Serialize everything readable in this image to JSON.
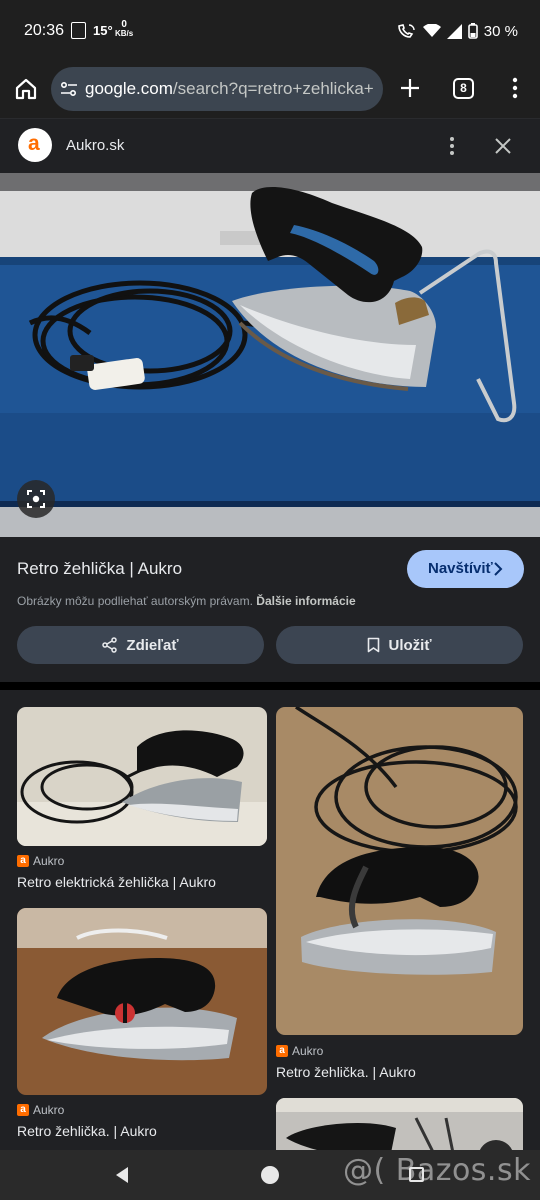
{
  "status_bar": {
    "time": "20:36",
    "temperature": "15°",
    "net_speed_value": "0",
    "net_speed_unit": "KB/s",
    "battery": "30 %"
  },
  "url_bar": {
    "host": "google.com",
    "path": "/search?q=retro+zehlicka+",
    "tab_count": "8"
  },
  "preview": {
    "source_logo_letter": "a",
    "source_name": "Aukro.sk",
    "title": "Retro žehlička | Aukro",
    "visit_label": "Navštíviť",
    "copyright_text": "Obrázky môžu podliehať autorským právam.",
    "more_info_label": "Ďalšie informácie",
    "share_label": "Zdieľať",
    "save_label": "Uložiť"
  },
  "results": [
    {
      "source": "Aukro",
      "title": "Retro elektrická žehlička | Aukro"
    },
    {
      "source": "Aukro",
      "title": "Retro žehlička. | Aukro"
    },
    {
      "source": "Aukro",
      "title": "Retro žehlička. | Aukro"
    },
    {
      "source": "",
      "title": ""
    }
  ],
  "watermark": "@( Bazos.sk",
  "colors": {
    "accent_button": "#a8c7fa",
    "aukro_orange": "#ff6d00",
    "background": "#202124"
  },
  "icons": [
    "home-icon",
    "site-settings-icon",
    "plus-icon",
    "tabs-icon",
    "more-vert-icon",
    "close-icon",
    "lens-icon",
    "chevron-right-icon",
    "share-icon",
    "bookmark-icon",
    "back-icon",
    "home-nav-icon",
    "recents-icon"
  ]
}
